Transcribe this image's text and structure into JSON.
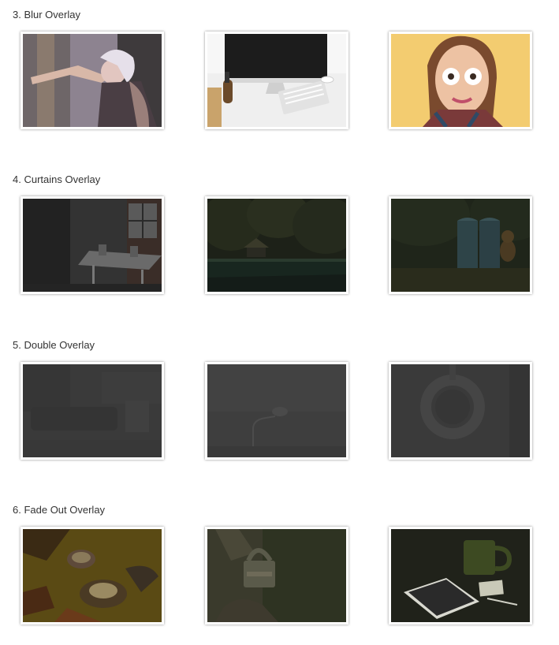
{
  "sections": [
    {
      "title": "3. Blur Overlay",
      "images": [
        {
          "subject": "woman-tattoo-photo",
          "colors": [
            "#b6a9b8",
            "#5a4f55",
            "#d8c9d6"
          ]
        },
        {
          "subject": "desk-imac-photo",
          "colors": [
            "#f3f3f3",
            "#222222",
            "#c9a36b"
          ]
        },
        {
          "subject": "surprised-woman-photo",
          "colors": [
            "#f2c86a",
            "#e3b080",
            "#5a3c30"
          ]
        }
      ]
    },
    {
      "title": "4. Curtains Overlay",
      "images": [
        {
          "subject": "meeting-room-photo",
          "colors": [
            "#2d2d2d",
            "#4a4a4a",
            "#6a6a6a"
          ]
        },
        {
          "subject": "park-pavilion-photo",
          "colors": [
            "#1f2418",
            "#2c3a2a",
            "#1a2a22"
          ]
        },
        {
          "subject": "portable-toilets-photo",
          "colors": [
            "#222a1e",
            "#2b3f44",
            "#3a3320"
          ]
        }
      ]
    },
    {
      "title": "5. Double Overlay",
      "images": [
        {
          "subject": "living-room-photo",
          "colors": [
            "#3a3a3a",
            "#353535",
            "#414141"
          ]
        },
        {
          "subject": "street-lamp-photo",
          "colors": [
            "#3e3e3e",
            "#3b3b3b",
            "#484848"
          ]
        },
        {
          "subject": "wreath-photo",
          "colors": [
            "#3a3a3a",
            "#383838",
            "#454545"
          ]
        }
      ]
    },
    {
      "title": "6. Fade Out Overlay",
      "images": [
        {
          "subject": "candles-photo",
          "colors": [
            "#5c4a14",
            "#3a2a14",
            "#7a6a32"
          ]
        },
        {
          "subject": "padlock-photo",
          "colors": [
            "#2f3423",
            "#4a4a3a",
            "#2a2a1e"
          ]
        },
        {
          "subject": "tablet-mug-photo",
          "colors": [
            "#20221a",
            "#3b4a22",
            "#d9d9d0"
          ]
        }
      ]
    }
  ]
}
